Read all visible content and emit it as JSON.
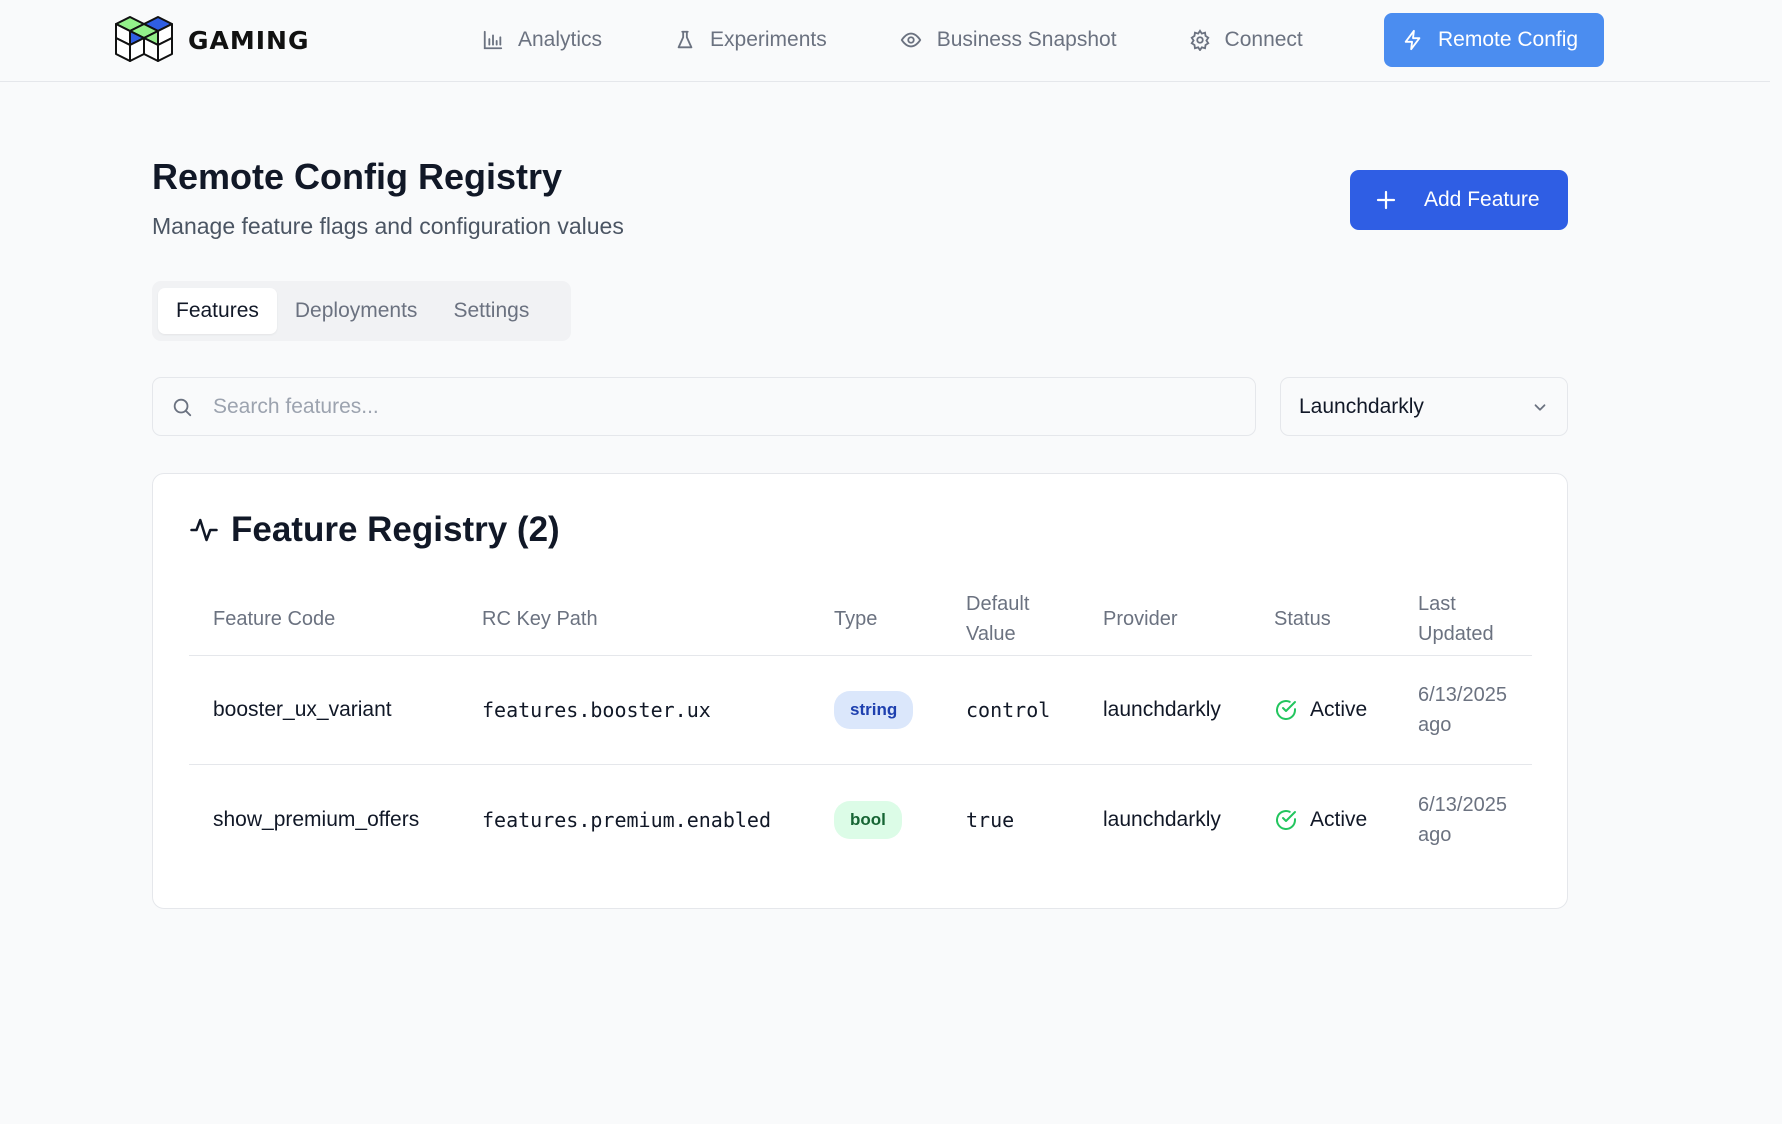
{
  "brand": {
    "name": "GAMING"
  },
  "nav": {
    "items": [
      {
        "label": "Analytics",
        "icon": "bar-chart-icon"
      },
      {
        "label": "Experiments",
        "icon": "flask-icon"
      },
      {
        "label": "Business Snapshot",
        "icon": "eye-icon"
      },
      {
        "label": "Connect",
        "icon": "gear-icon"
      }
    ],
    "active": {
      "label": "Remote Config",
      "icon": "lightning-icon"
    }
  },
  "page": {
    "title": "Remote Config Registry",
    "subtitle": "Manage feature flags and configuration values",
    "add_button_label": "Add Feature"
  },
  "tabs": [
    {
      "label": "Features",
      "active": true
    },
    {
      "label": "Deployments",
      "active": false
    },
    {
      "label": "Settings",
      "active": false
    }
  ],
  "search": {
    "placeholder": "Search features...",
    "value": ""
  },
  "provider_select": {
    "value": "Launchdarkly"
  },
  "registry": {
    "title": "Feature Registry (2)",
    "columns": {
      "feature_code": "Feature Code",
      "rc_key_path": "RC Key Path",
      "type": "Type",
      "default_value": "Default Value",
      "provider": "Provider",
      "status": "Status",
      "last_updated": "Last Updated"
    },
    "rows": [
      {
        "feature_code": "booster_ux_variant",
        "rc_key_path": "features.booster.ux",
        "type": "string",
        "default_value": "control",
        "provider": "launchdarkly",
        "status": "Active",
        "last_updated": "6/13/2025 ago"
      },
      {
        "feature_code": "show_premium_offers",
        "rc_key_path": "features.premium.enabled",
        "type": "bool",
        "default_value": "true",
        "provider": "launchdarkly",
        "status": "Active",
        "last_updated": "6/13/2025 ago"
      }
    ]
  },
  "colors": {
    "accent": "#2f5ee4",
    "nav_active": "#4b8df0",
    "status_active": "#22c55e"
  }
}
